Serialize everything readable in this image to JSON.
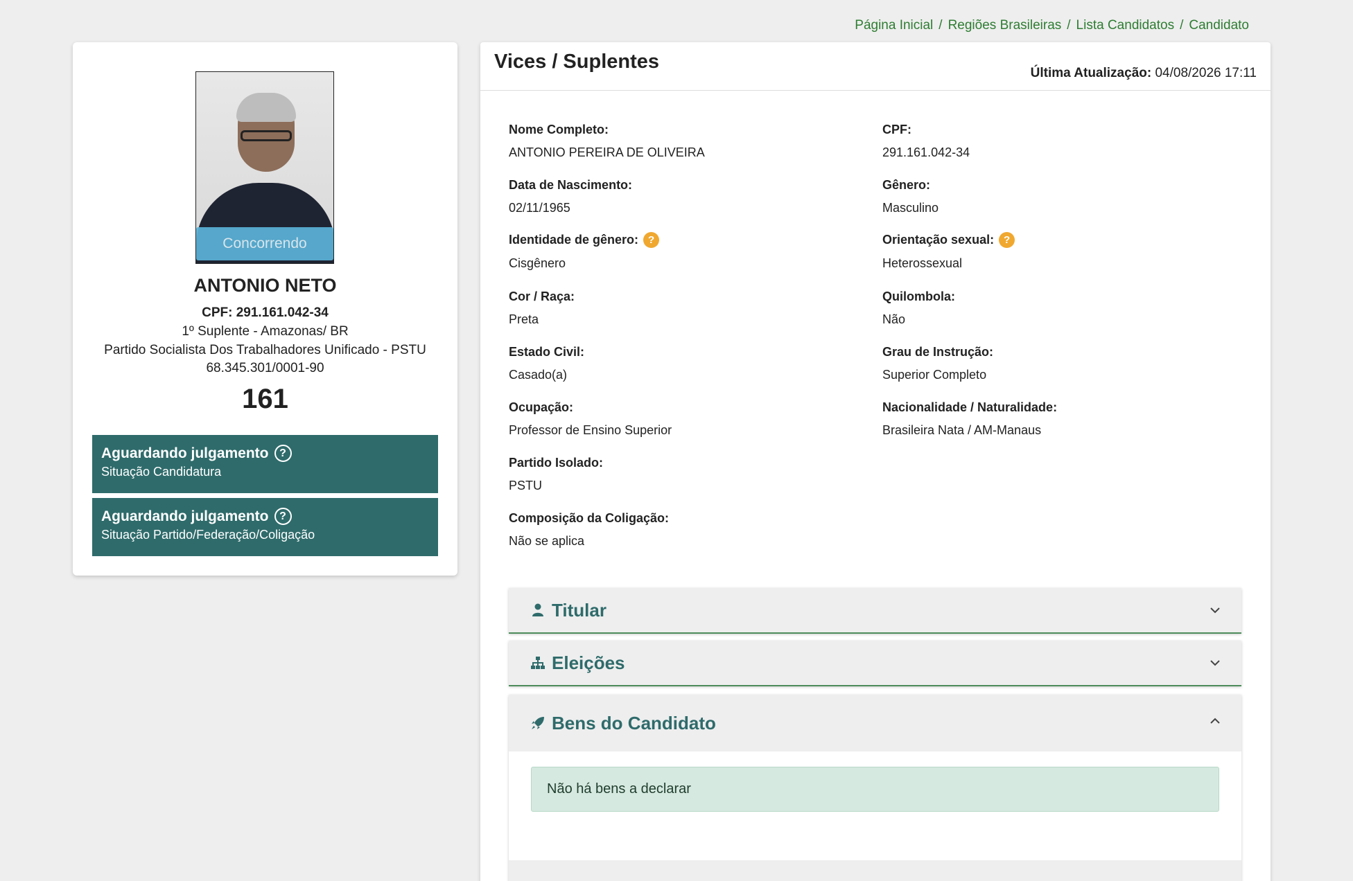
{
  "breadcrumb": [
    "Página Inicial",
    "Regiões Brasileiras",
    "Lista Candidatos",
    "Candidato"
  ],
  "candidate": {
    "photo_status": "Concorrendo",
    "name": "ANTONIO NETO",
    "cpf_line": "CPF: 291.161.042-34",
    "role": "1º Suplente - Amazonas/ BR",
    "party": "Partido Socialista Dos Trabalhadores Unificado - PSTU",
    "cnpj": "68.345.301/0001-90",
    "number": "161",
    "situations": [
      {
        "title": "Aguardando julgamento",
        "subtitle": "Situação Candidatura"
      },
      {
        "title": "Aguardando julgamento",
        "subtitle": "Situação Partido/Federação/Coligação"
      }
    ]
  },
  "details": {
    "title": "Vices / Suplentes",
    "update_label": "Última Atualização:",
    "update_value": "04/08/2026 17:11",
    "fields": {
      "nome_label": "Nome Completo:",
      "nome_value": "ANTONIO PEREIRA DE OLIVEIRA",
      "cpf_label": "CPF:",
      "cpf_value": "291.161.042-34",
      "nasc_label": "Data de Nascimento:",
      "nasc_value": "02/11/1965",
      "genero_label": "Gênero:",
      "genero_value": "Masculino",
      "idgen_label": "Identidade de gênero:",
      "idgen_value": "Cisgênero",
      "orient_label": "Orientação sexual:",
      "orient_value": "Heterossexual",
      "cor_label": "Cor / Raça:",
      "cor_value": "Preta",
      "quil_label": "Quilombola:",
      "quil_value": "Não",
      "civil_label": "Estado Civil:",
      "civil_value": "Casado(a)",
      "grau_label": "Grau de Instrução:",
      "grau_value": "Superior Completo",
      "ocup_label": "Ocupação:",
      "ocup_value": "Professor de Ensino Superior",
      "nac_label": "Nacionalidade / Naturalidade:",
      "nac_value": "Brasileira Nata / AM-Manaus",
      "partido_label": "Partido Isolado:",
      "partido_value": "PSTU",
      "colig_label": "Composição da Coligação:",
      "colig_value": "Não se aplica"
    }
  },
  "panels": {
    "titular": "Titular",
    "eleicoes": "Eleições",
    "bens": "Bens do Candidato",
    "bens_message": "Não há bens a declarar"
  },
  "help_glyph": "?",
  "colors": {
    "accent": "#2f6b6b",
    "link": "#2e7d32",
    "status_bar": "#5bb3d8",
    "help": "#f0a830"
  }
}
